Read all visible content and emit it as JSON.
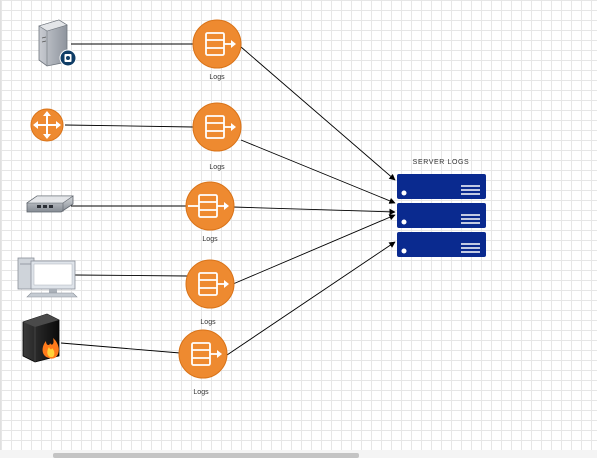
{
  "log_label": "Logs",
  "server_title": "SERVER  LOGS",
  "colors": {
    "log_orange": "#ee8a30",
    "log_border": "#d97318",
    "server_blue": "#0a2a8f",
    "edge": "#000000"
  },
  "sources": [
    {
      "name": "server-computer",
      "icon": "server-tower-icon"
    },
    {
      "name": "router",
      "icon": "router-icon"
    },
    {
      "name": "switch",
      "icon": "network-switch-icon"
    },
    {
      "name": "desktop-pc",
      "icon": "desktop-computer-icon"
    },
    {
      "name": "firewall",
      "icon": "firewall-icon"
    }
  ]
}
